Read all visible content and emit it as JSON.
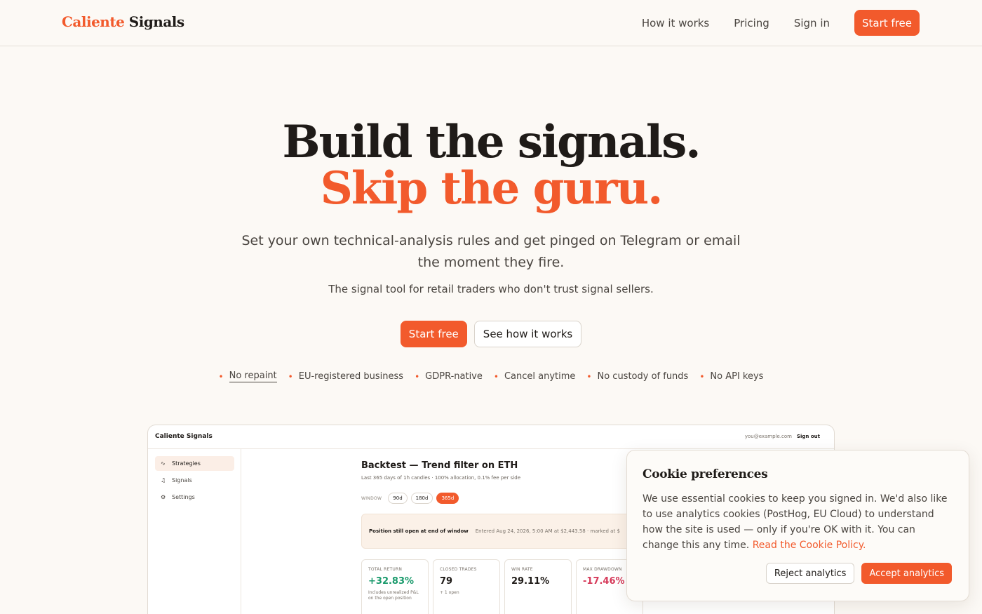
{
  "nav": {
    "brand_part1": "Caliente",
    "brand_part2": "Signals",
    "links": [
      "How it works",
      "Pricing",
      "Sign in"
    ],
    "cta": "Start free"
  },
  "hero": {
    "title_line1": "Build the signals.",
    "title_line2": "Skip the guru.",
    "lede": "Set your own technical-analysis rules and get pinged on Telegram or email the moment they fire.",
    "sublede": "The signal tool for retail traders who don't trust signal sellers.",
    "cta_primary": "Start free",
    "cta_secondary": "See how it works",
    "badges": [
      "No repaint",
      "EU-registered business",
      "GDPR-native",
      "Cancel anytime",
      "No custody of funds",
      "No API keys"
    ]
  },
  "preview": {
    "brand": "Caliente Signals",
    "email": "you@example.com",
    "signout": "Sign out",
    "sidebar": [
      {
        "label": "Strategies",
        "icon": "activity-icon"
      },
      {
        "label": "Signals",
        "icon": "bell-icon"
      },
      {
        "label": "Settings",
        "icon": "gear-icon"
      }
    ],
    "title": "Backtest — Trend filter on ETH",
    "subtitle": "Last 365 days of 1h candles · 100% allocation, 0.1% fee per side",
    "window_label": "WINDOW",
    "windows": [
      "90d",
      "180d",
      "365d"
    ],
    "active_window": "365d",
    "note_strong": "Position still open at end of window",
    "note_soft": "Entered Aug 24, 2026, 5:00 AM at $2,443.58 · marked at $",
    "stats": [
      {
        "label": "TOTAL RETURN",
        "value": "+32.83%",
        "sub": "Includes unrealized P&L on the open position"
      },
      {
        "label": "CLOSED TRADES",
        "value": "79",
        "sub": "+ 1 open"
      },
      {
        "label": "WIN RATE",
        "value": "29.11%",
        "sub": ""
      },
      {
        "label": "MAX DRAWDOWN",
        "value": "-17.46%",
        "sub": ""
      }
    ]
  },
  "cookie": {
    "title": "Cookie preferences",
    "body": "We use essential cookies to keep you signed in. We'd also like to use analytics cookies (PostHog, EU Cloud) to understand how the site is used — only if you're OK with it. You can change this any time.",
    "link": "Read the Cookie Policy.",
    "reject": "Reject analytics",
    "accept": "Accept analytics"
  },
  "colors": {
    "accent": "#f25a2c",
    "positive": "#1a9a6c",
    "negative": "#d63a5a",
    "background": "#fcf9f5"
  }
}
